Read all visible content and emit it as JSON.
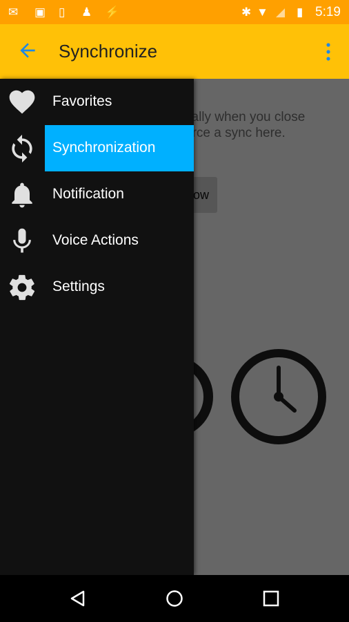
{
  "status_bar": {
    "time": "5:19",
    "icons": [
      "mail-check-icon",
      "image-icon",
      "watch-icon",
      "android-icon",
      "flash-icon",
      "bluetooth-icon",
      "wifi-icon",
      "signal-icon",
      "battery-charging-icon"
    ]
  },
  "app_bar": {
    "title": "Synchronize",
    "back_icon": "arrow-back-icon",
    "menu_icon": "more-vert-icon"
  },
  "content": {
    "description_visible": "cally when you close\norce a sync here.",
    "sync_button_visible": "ow"
  },
  "drawer": {
    "selected_color": "#00B0FF",
    "items": [
      {
        "label": "Favorites",
        "icon": "heart-icon"
      },
      {
        "label": "Synchronization",
        "icon": "sync-icon",
        "selected": true
      },
      {
        "label": "Notification",
        "icon": "bell-icon"
      },
      {
        "label": "Voice Actions",
        "icon": "microphone-icon"
      },
      {
        "label": "Settings",
        "icon": "gear-icon"
      }
    ]
  },
  "colors": {
    "status_bar": "#FFA000",
    "app_bar": "#FFC107",
    "accent": "#00B0FF"
  }
}
